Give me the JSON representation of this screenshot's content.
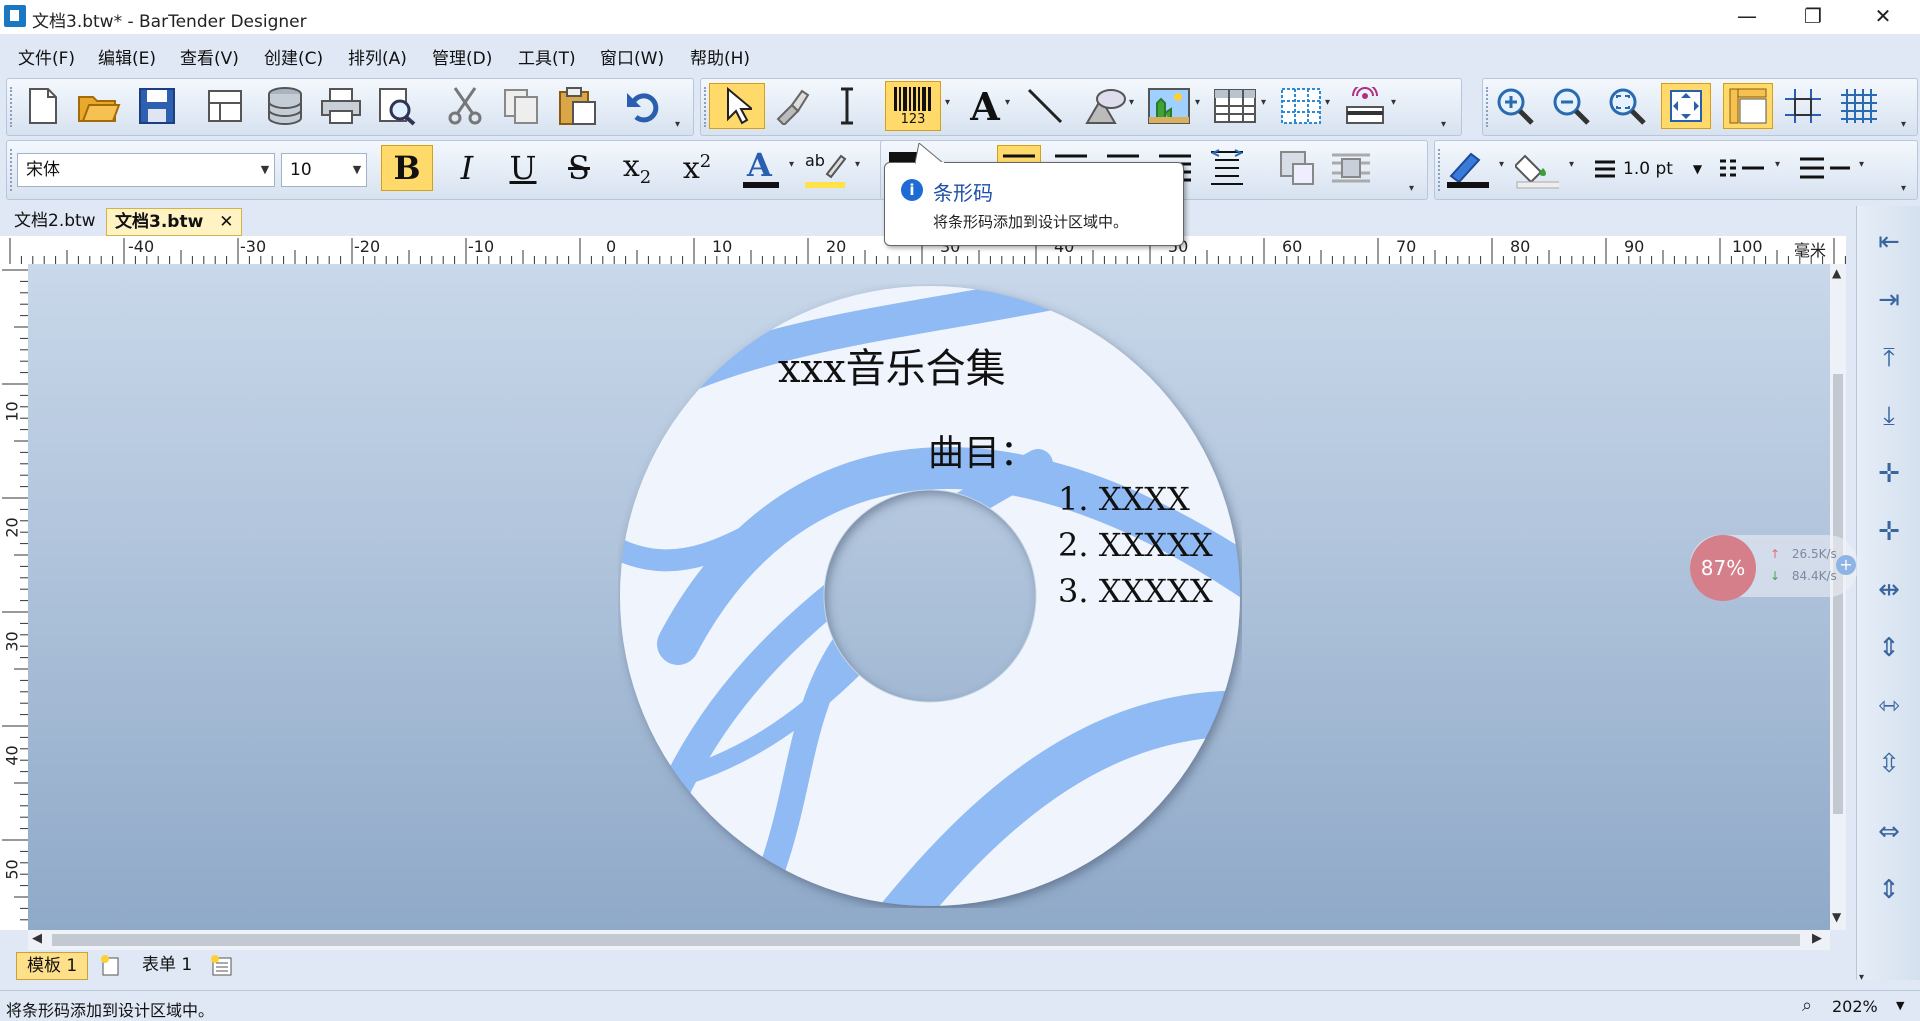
{
  "window": {
    "title": "文档3.btw* - BarTender Designer",
    "controls": [
      "—",
      "❐",
      "✕"
    ]
  },
  "menu": {
    "items": [
      "文件(F)",
      "编辑(E)",
      "查看(V)",
      "创建(C)",
      "排列(A)",
      "管理(D)",
      "工具(T)",
      "窗口(W)",
      "帮助(H)"
    ]
  },
  "toolbar": {
    "barcode_label": "123"
  },
  "font_toolbar": {
    "font_name": "宋体",
    "font_size": "10",
    "line_width": "1.0 pt"
  },
  "tooltip": {
    "title": "条形码",
    "body": "将条形码添加到设计区域中。"
  },
  "doc_tabs": [
    {
      "label": "文档2.btw",
      "active": false
    },
    {
      "label": "文档3.btw",
      "active": true
    }
  ],
  "doc_tab_close": "✕",
  "ruler": {
    "h_numbers": [
      "-40",
      "-30",
      "-20",
      "-10",
      "0",
      "10",
      "20",
      "30",
      "40",
      "50",
      "60",
      "70",
      "80",
      "90",
      "100"
    ],
    "unit": "毫米",
    "v_numbers": [
      "10",
      "20",
      "30",
      "40",
      "50"
    ]
  },
  "disc": {
    "title": "xxx音乐合集",
    "subtitle": "曲目：",
    "tracks": [
      "1. XXXX",
      "2. XXXXX",
      "3. XXXXX"
    ]
  },
  "sheet_tabs": [
    "模板 1",
    "表单 1"
  ],
  "status": {
    "message": "将条形码添加到设计区域中。",
    "zoom": "202%"
  },
  "speed_widget": {
    "percent": "87%",
    "upload": "26.5K/s",
    "download": "84.4K/s"
  },
  "colors": {
    "accent": "#ffd96a",
    "disc_stroke": "#6aa2ee",
    "canvas_top": "#c9d8ea",
    "canvas_bottom": "#8fa9c8"
  }
}
